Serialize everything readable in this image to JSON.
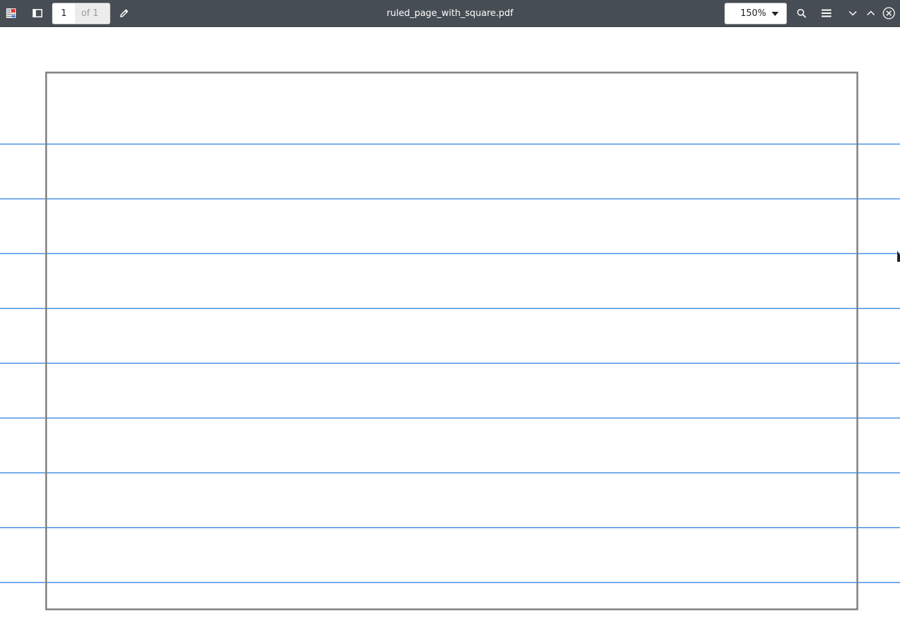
{
  "app": {
    "icon": "document-viewer-app-icon"
  },
  "toolbar": {
    "sidebar_toggle_icon": "sidebar-toggle-icon",
    "page_input_value": "1",
    "page_count": "of 1",
    "annotate_icon": "pencil-icon",
    "title": "ruled_page_with_square.pdf",
    "zoom_value": "150%",
    "search_icon": "search-icon",
    "menu_icon": "hamburger-menu-icon",
    "next_icon": "chevron-down-icon",
    "prev_icon": "chevron-up-icon",
    "close_icon": "close-circle-icon"
  },
  "document": {
    "ruled_lines": 9,
    "colors": {
      "toolbar_bg": "#474d54",
      "rule_line": "#4a90e2",
      "square_border": "#7f7f7f",
      "page_bg": "#ffffff"
    }
  }
}
